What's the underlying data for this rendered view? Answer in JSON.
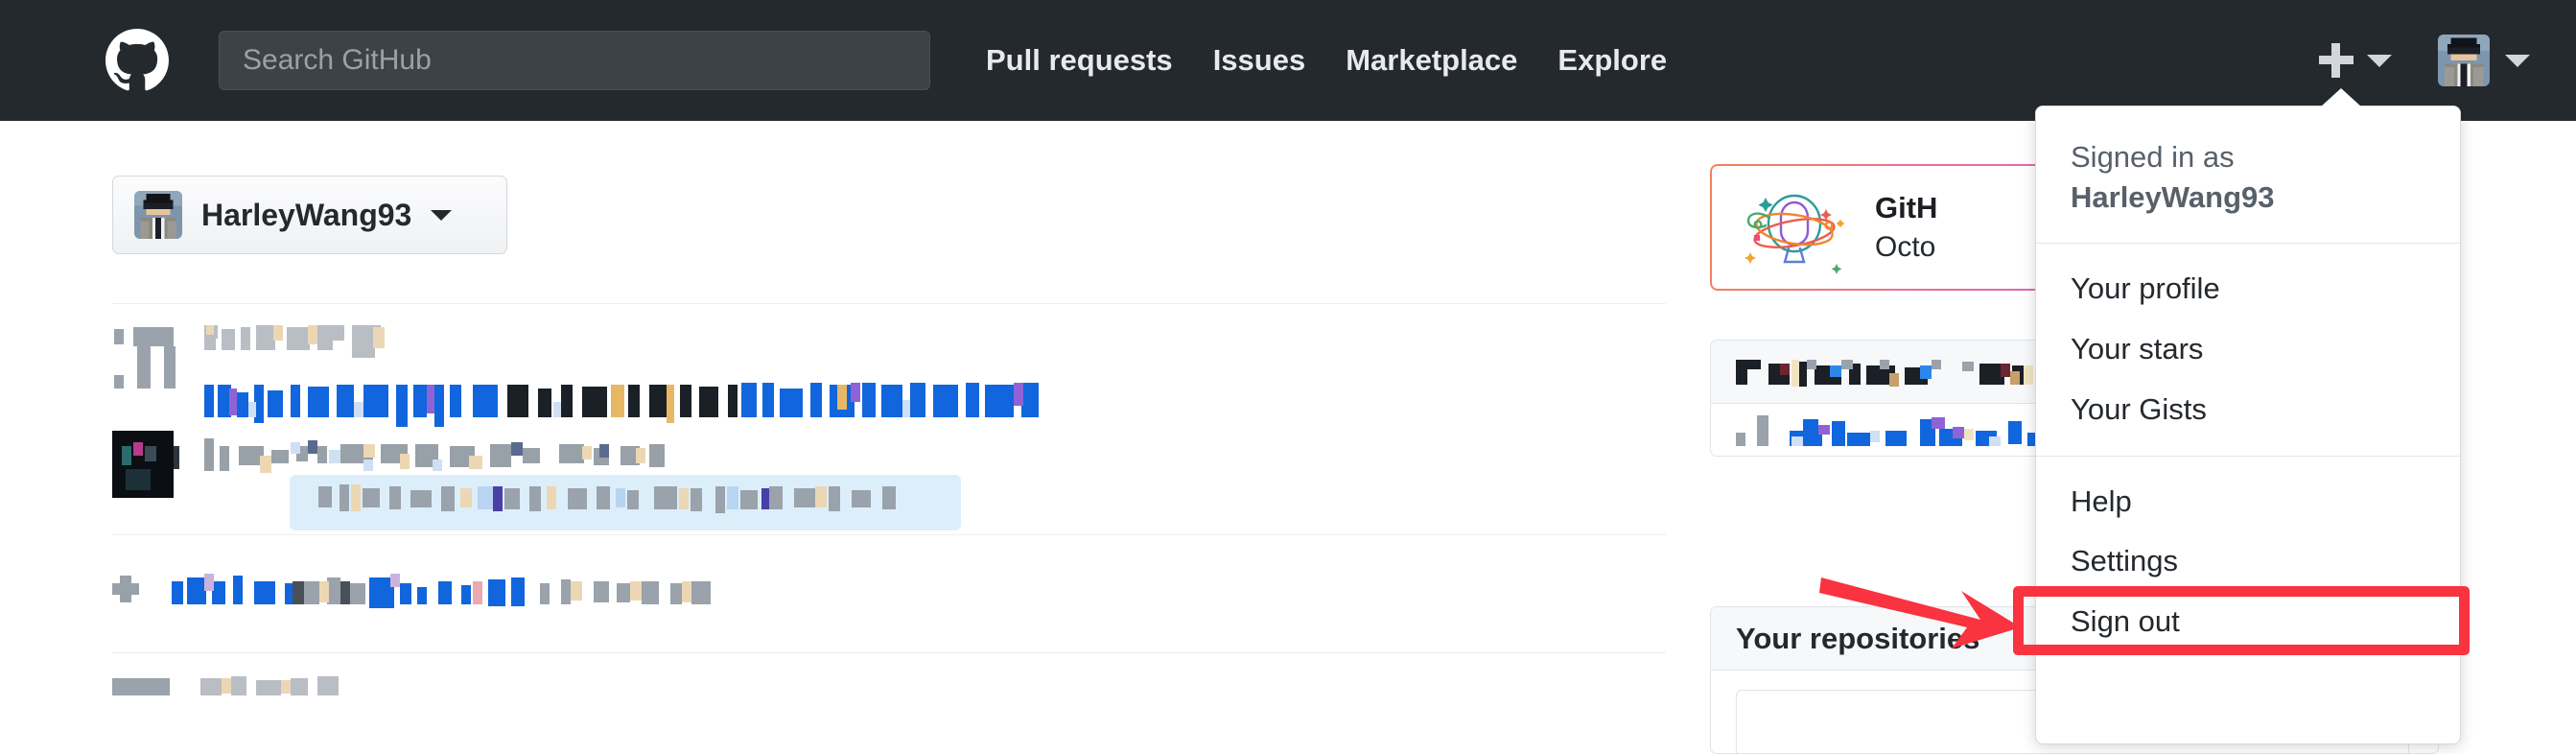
{
  "header": {
    "logo_icon": "github-mark-icon",
    "search": {
      "placeholder": "Search GitHub",
      "value": ""
    },
    "nav": [
      {
        "label": "Pull requests"
      },
      {
        "label": "Issues"
      },
      {
        "label": "Marketplace"
      },
      {
        "label": "Explore"
      }
    ],
    "create_new_icon": "plus-icon",
    "create_new_caret_icon": "chevron-down-icon",
    "avatar_icon": "user-avatar-detective-icon",
    "avatar_caret_icon": "chevron-down-icon"
  },
  "main": {
    "user_button": {
      "username": "HarleyWang93",
      "avatar_icon": "user-avatar-detective-icon",
      "caret_icon": "chevron-down-icon"
    },
    "feed": {
      "note": "news feed content is pixelated / redacted in the screenshot",
      "rows": [
        {
          "id": "feed-row-1"
        },
        {
          "id": "feed-row-2"
        },
        {
          "id": "feed-row-3"
        }
      ]
    },
    "rail": {
      "promo": {
        "illustration_icon": "octocat-planet-icon",
        "line1": "GitH",
        "line2": "Octo"
      },
      "card_redacted": {
        "note": "card header and body text are pixelated / redacted"
      },
      "repositories_card": {
        "title": "Your repositories"
      }
    }
  },
  "user_menu": {
    "signed_in_label": "Signed in as",
    "signed_in_username": "HarleyWang93",
    "groups": [
      {
        "items": [
          {
            "label": "Your profile"
          },
          {
            "label": "Your stars"
          },
          {
            "label": "Your Gists"
          }
        ]
      },
      {
        "items": [
          {
            "label": "Help"
          },
          {
            "label": "Settings",
            "highlighted": true
          },
          {
            "label": "Sign out"
          }
        ]
      }
    ]
  },
  "annotations": {
    "highlight_color": "#f9333f",
    "highlight_target": "Settings",
    "arrow_icon": "red-arrow-right-icon",
    "box_icon": "red-highlight-box"
  },
  "colors": {
    "header_bg": "#24292e",
    "search_bg": "#3d4246",
    "page_bg": "#ffffff",
    "text_primary": "#24292e",
    "text_muted": "#586069",
    "border": "#e1e4e8",
    "annotation_red": "#f9333f"
  }
}
